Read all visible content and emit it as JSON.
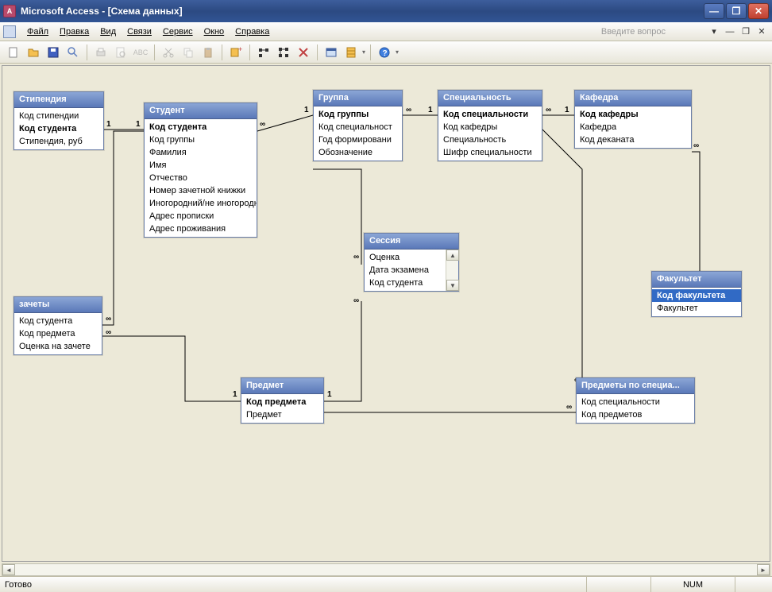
{
  "window": {
    "title": "Microsoft Access - [Схема данных]",
    "help_placeholder": "Введите вопрос"
  },
  "menu": {
    "file": "Файл",
    "edit": "Правка",
    "view": "Вид",
    "relations": "Связи",
    "service": "Сервис",
    "window": "Окно",
    "help": "Справка"
  },
  "statusbar": {
    "ready": "Готово",
    "num": "NUM"
  },
  "tables": {
    "stipendia": {
      "title": "Стипендия",
      "fields": [
        "Код стипендии",
        "Код студента",
        "Стипендия, руб"
      ],
      "pk": [
        1
      ]
    },
    "student": {
      "title": "Студент",
      "fields": [
        "Код студента",
        "Код группы",
        "Фамилия",
        "Имя",
        "Отчество",
        "Номер зачетной книжки",
        "Иногородний/не иногородн",
        "Адрес прописки",
        "Адрес проживания"
      ],
      "pk": [
        0
      ]
    },
    "gruppa": {
      "title": "Группа",
      "fields": [
        "Код группы",
        "Код специальност",
        "Год формировани",
        "Обозначение"
      ],
      "pk": [
        0
      ]
    },
    "specialnost": {
      "title": "Специальность",
      "fields": [
        "Код специальности",
        "Код кафедры",
        "Специальность",
        "Шифр специальности"
      ],
      "pk": [
        0
      ]
    },
    "kafedra": {
      "title": "Кафедра",
      "fields": [
        "Код кафедры",
        "Кафедра",
        "Код деканата"
      ],
      "pk": [
        0
      ]
    },
    "zachety": {
      "title": "зачеты",
      "fields": [
        "Код студента",
        "Код предмета",
        "Оценка на зачете"
      ],
      "pk": []
    },
    "sessia": {
      "title": "Сессия",
      "fields": [
        "Оценка",
        "Дата экзамена",
        "Код студента"
      ],
      "pk": []
    },
    "predmet": {
      "title": "Предмет",
      "fields": [
        "Код предмета",
        "Предмет"
      ],
      "pk": [
        0
      ]
    },
    "fakultet": {
      "title": "Факультет",
      "fields": [
        "Код факультета",
        "Факультет"
      ],
      "pk": [
        0
      ],
      "selected": 0
    },
    "predmety_spec": {
      "title": "Предметы по специа...",
      "fields": [
        "Код специальности",
        "Код предметов"
      ],
      "pk": []
    }
  }
}
